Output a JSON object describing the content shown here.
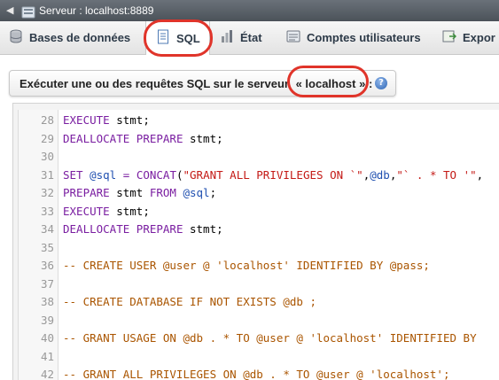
{
  "topbar": {
    "arrow": "◀",
    "server_label": "Serveur : localhost:8889"
  },
  "tabs": [
    {
      "label": "Bases de données",
      "icon": "database-icon"
    },
    {
      "label": "SQL",
      "icon": "sql-document-icon"
    },
    {
      "label": "État",
      "icon": "status-chart-icon"
    },
    {
      "label": "Comptes utilisateurs",
      "icon": "users-icon"
    },
    {
      "label": "Expor",
      "icon": "export-icon"
    }
  ],
  "section": {
    "title": "Exécuter une ou des requêtes SQL sur le serveur",
    "host": "« localhost »",
    "suffix": ":",
    "help": "?"
  },
  "editor": {
    "lines": [
      {
        "n": "28",
        "code": "EXECUTE stmt;"
      },
      {
        "n": "29",
        "code": "DEALLOCATE PREPARE stmt;"
      },
      {
        "n": "30",
        "code": ""
      },
      {
        "n": "31",
        "code": "SET @sql = CONCAT(\"GRANT ALL PRIVILEGES ON `\",@db,\"` . * TO '\","
      },
      {
        "n": "32",
        "code": "PREPARE stmt FROM @sql;"
      },
      {
        "n": "33",
        "code": "EXECUTE stmt;"
      },
      {
        "n": "34",
        "code": "DEALLOCATE PREPARE stmt;"
      },
      {
        "n": "35",
        "code": ""
      },
      {
        "n": "36",
        "code": "-- CREATE USER @user @ 'localhost' IDENTIFIED BY @pass;"
      },
      {
        "n": "37",
        "code": ""
      },
      {
        "n": "38",
        "code": "-- CREATE DATABASE IF NOT EXISTS @db ;"
      },
      {
        "n": "39",
        "code": ""
      },
      {
        "n": "40",
        "code": "-- GRANT USAGE ON @db . * TO @user @ 'localhost' IDENTIFIED BY"
      },
      {
        "n": "41",
        "code": ""
      },
      {
        "n": "42",
        "code": "-- GRANT ALL PRIVILEGES ON @db . * TO @user @ 'localhost';"
      }
    ]
  },
  "colors": {
    "highlight_oval": "#e0342a",
    "keyword": "#7a1ea1",
    "variable": "#1f4fb0",
    "string": "#c41a16",
    "comment": "#aa5500"
  }
}
